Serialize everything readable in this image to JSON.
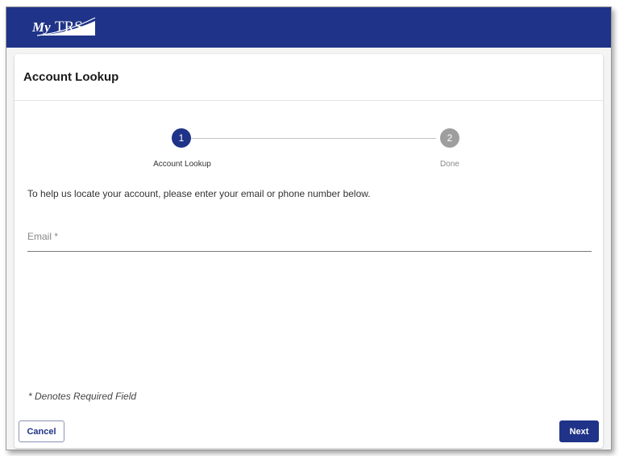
{
  "header": {
    "logo_text": "MyTRS",
    "brand_color": "#1f3388"
  },
  "page": {
    "title": "Account Lookup"
  },
  "stepper": {
    "steps": [
      {
        "number": "1",
        "label": "Account Lookup",
        "state": "active"
      },
      {
        "number": "2",
        "label": "Done",
        "state": "inactive"
      }
    ],
    "active_color": "#1f3388",
    "inactive_color": "#9e9e9e"
  },
  "form": {
    "intro": "To help us locate your account, please enter your email or phone number below.",
    "email_placeholder": "Email *",
    "email_value": "",
    "required_note": "* Denotes Required Field"
  },
  "actions": {
    "cancel_label": "Cancel",
    "next_label": "Next"
  }
}
